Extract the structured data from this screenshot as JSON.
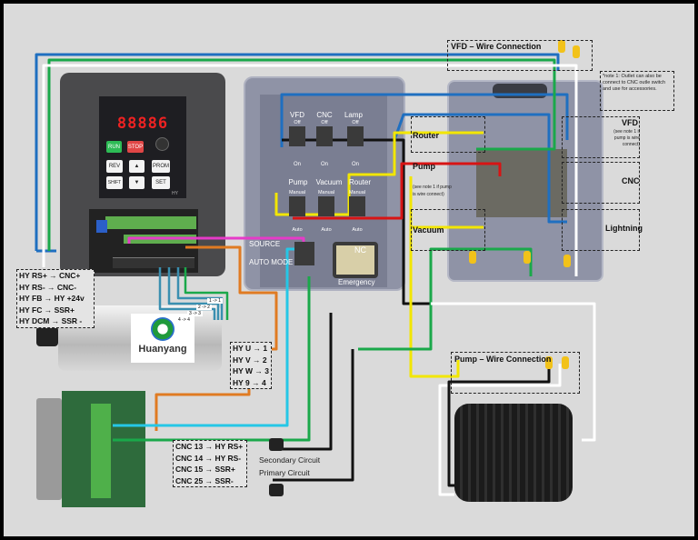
{
  "vfd_device": {
    "display": "88886",
    "run": "RUN",
    "stop": "STOP",
    "rev": "REV",
    "prom": "PROM",
    "shift": "SHIFT",
    "set": "SET",
    "brand": "HY"
  },
  "spindle": {
    "brand": "Huanyang"
  },
  "vfd_cnc_map": [
    "HY RS+ → CNC+",
    "HY RS- → CNC-",
    "HY FB → HY +24v",
    "HY FC → SSR+",
    "HY DCM → SSR -"
  ],
  "motor_map": [
    "HY U → 1",
    "HY V → 2",
    "HY W → 3",
    "HY 9 → 4"
  ],
  "motor_tags": [
    "1 -> 1",
    "2 -> 2",
    "3 -> 3",
    "4 -> 4"
  ],
  "cnc_map": [
    "CNC 13 → HY RS+",
    "CNC 14 → HY RS-",
    "CNC 15 → SSR+",
    "CNC 25 → SSR-"
  ],
  "switch_panel": {
    "top": [
      "VFD",
      "CNC",
      "Lamp"
    ],
    "top_off": "Off",
    "top_on": "On",
    "bottom": [
      "Pump",
      "Vacuum",
      "Router"
    ],
    "bottom_mode": "Manual",
    "bottom_auto": "Auto",
    "source": "SOURCE",
    "auto_mode": "AUTO MODE",
    "nc": "NC",
    "emergency": "Emergency"
  },
  "outlet_labels": {
    "router": "Router",
    "pump": "Pump",
    "pump_note": "(see note 1 if pump is wire connect)",
    "vacuum": "Vacuum",
    "vfd": "VFD",
    "vfd_note": "(see note 1 if pump is wire connect)",
    "cnc": "CNC",
    "lightning": "Lightning"
  },
  "vfd_wire_connection": "VFD – Wire Connection",
  "pump_wire_connection": "Pump – Wire Connection",
  "note1": "*note 1: Outlet can also be connect to CNC outle switch and use for accessories.",
  "plugs": {
    "secondary": "Secondary Circuit",
    "primary": "Primary Circuit"
  },
  "wire_colors": {
    "blue": "#1f6fc0",
    "green": "#1aa84a",
    "white": "#ffffff",
    "black": "#111111",
    "yellow": "#f2e600",
    "red": "#d81414",
    "pink": "#e63bc8",
    "orange": "#e07b22",
    "teal": "#3a8fb0",
    "cyan": "#25c7e6",
    "purple": "#8e6bb8"
  }
}
